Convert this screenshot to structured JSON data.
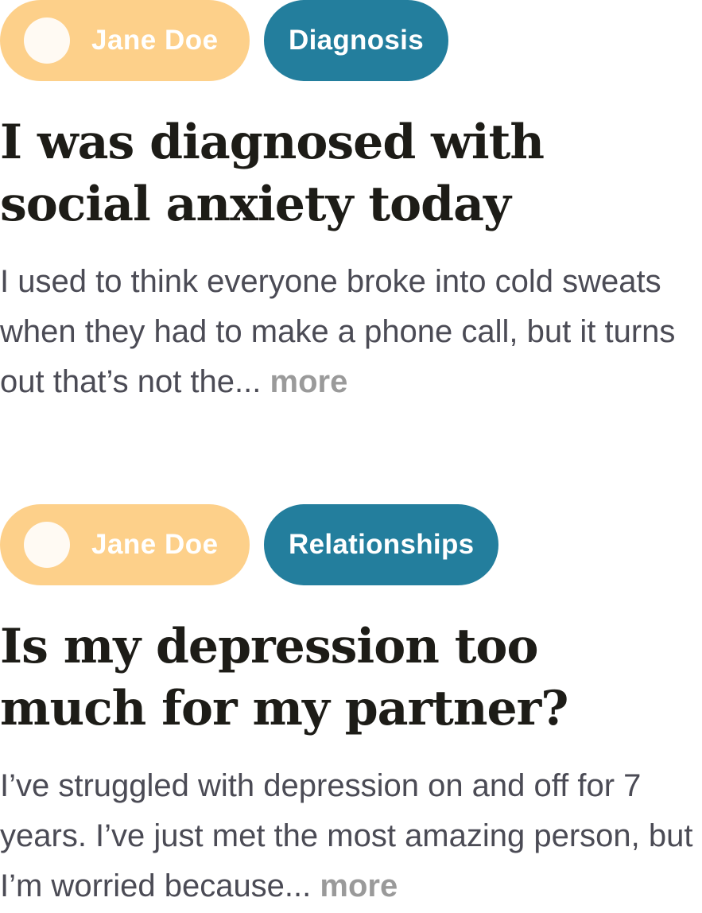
{
  "posts": [
    {
      "author": "Jane Doe",
      "category": "Diagnosis",
      "title_line1": "I was diagnosed with",
      "title_line2": "social anxiety today",
      "excerpt": "I used to think everyone broke into cold sweats when they had to make a phone call, but it turns out that’s not the...",
      "more_label": "more"
    },
    {
      "author": "Jane Doe",
      "category": "Relationships",
      "title_line1": "Is my depression too",
      "title_line2": "much for my partner?",
      "excerpt": "I’ve struggled with depression on and off for 7 years. I’ve just met the most amazing person, but I’m worried because...",
      "more_label": "more"
    }
  ],
  "colors": {
    "author_chip": "#fdd08a",
    "category_chip": "#237e9d",
    "title_text": "#1d1c17",
    "excerpt_text": "#4b4b55",
    "more_text": "#9a9a9a"
  }
}
